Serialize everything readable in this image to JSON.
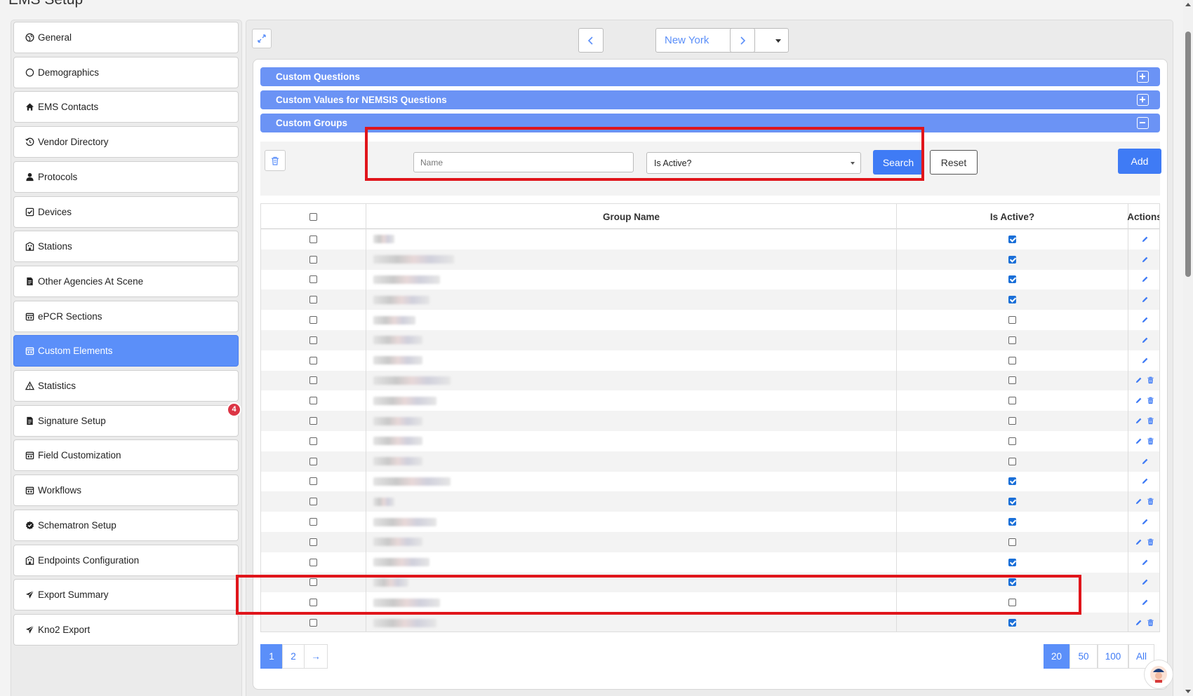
{
  "page": {
    "title": "EMS Setup"
  },
  "sidebar": {
    "items": [
      {
        "label": "General",
        "icon": "globe-icon"
      },
      {
        "label": "Demographics",
        "icon": "circle-icon"
      },
      {
        "label": "EMS Contacts",
        "icon": "home-icon"
      },
      {
        "label": "Vendor Directory",
        "icon": "history-icon"
      },
      {
        "label": "Protocols",
        "icon": "user-icon"
      },
      {
        "label": "Devices",
        "icon": "check-square-icon"
      },
      {
        "label": "Stations",
        "icon": "building-icon"
      },
      {
        "label": "Other Agencies At Scene",
        "icon": "document-icon"
      },
      {
        "label": "ePCR Sections",
        "icon": "calendar-icon"
      },
      {
        "label": "Custom Elements",
        "icon": "calendar-icon",
        "active": true
      },
      {
        "label": "Statistics",
        "icon": "warning-icon"
      },
      {
        "label": "Signature Setup",
        "icon": "document-icon",
        "badge": "4"
      },
      {
        "label": "Field Customization",
        "icon": "calendar-icon"
      },
      {
        "label": "Workflows",
        "icon": "calendar-icon"
      },
      {
        "label": "Schematron Setup",
        "icon": "badge-check-icon"
      },
      {
        "label": "Endpoints Configuration",
        "icon": "building-icon"
      },
      {
        "label": "Export Summary",
        "icon": "send-icon"
      },
      {
        "label": "Kno2 Export",
        "icon": "send-icon"
      }
    ]
  },
  "location": {
    "selected": "New York"
  },
  "sections": {
    "custom_questions": "Custom Questions",
    "custom_values": "Custom Values for NEMSIS Questions",
    "custom_groups": "Custom Groups"
  },
  "filters": {
    "name_placeholder": "Name",
    "is_active_label": "Is Active?",
    "search_label": "Search",
    "reset_label": "Reset",
    "add_label": "Add"
  },
  "table": {
    "headers": {
      "group_name": "Group Name",
      "is_active": "Is Active?",
      "actions": "Actions"
    },
    "rows": [
      {
        "active": true,
        "delete": false
      },
      {
        "active": true,
        "delete": false
      },
      {
        "active": true,
        "delete": false
      },
      {
        "active": true,
        "delete": false
      },
      {
        "active": false,
        "delete": false
      },
      {
        "active": false,
        "delete": false
      },
      {
        "active": false,
        "delete": false
      },
      {
        "active": false,
        "delete": true
      },
      {
        "active": false,
        "delete": true
      },
      {
        "active": false,
        "delete": true
      },
      {
        "active": false,
        "delete": true
      },
      {
        "active": false,
        "delete": false
      },
      {
        "active": true,
        "delete": false
      },
      {
        "active": true,
        "delete": true
      },
      {
        "active": true,
        "delete": false
      },
      {
        "active": false,
        "delete": true
      },
      {
        "active": true,
        "delete": false
      },
      {
        "active": true,
        "delete": false
      },
      {
        "active": false,
        "delete": false
      },
      {
        "active": true,
        "delete": true
      }
    ]
  },
  "pagination": {
    "pages": [
      "1",
      "2"
    ],
    "current": "1",
    "next": "→",
    "sizes": [
      "20",
      "50",
      "100",
      "All"
    ],
    "size_selected": "20"
  },
  "colors": {
    "accent": "#5b8ff9",
    "primary_button": "#3f7bf5",
    "highlight": "#e0151b",
    "badge": "#dc3545"
  }
}
